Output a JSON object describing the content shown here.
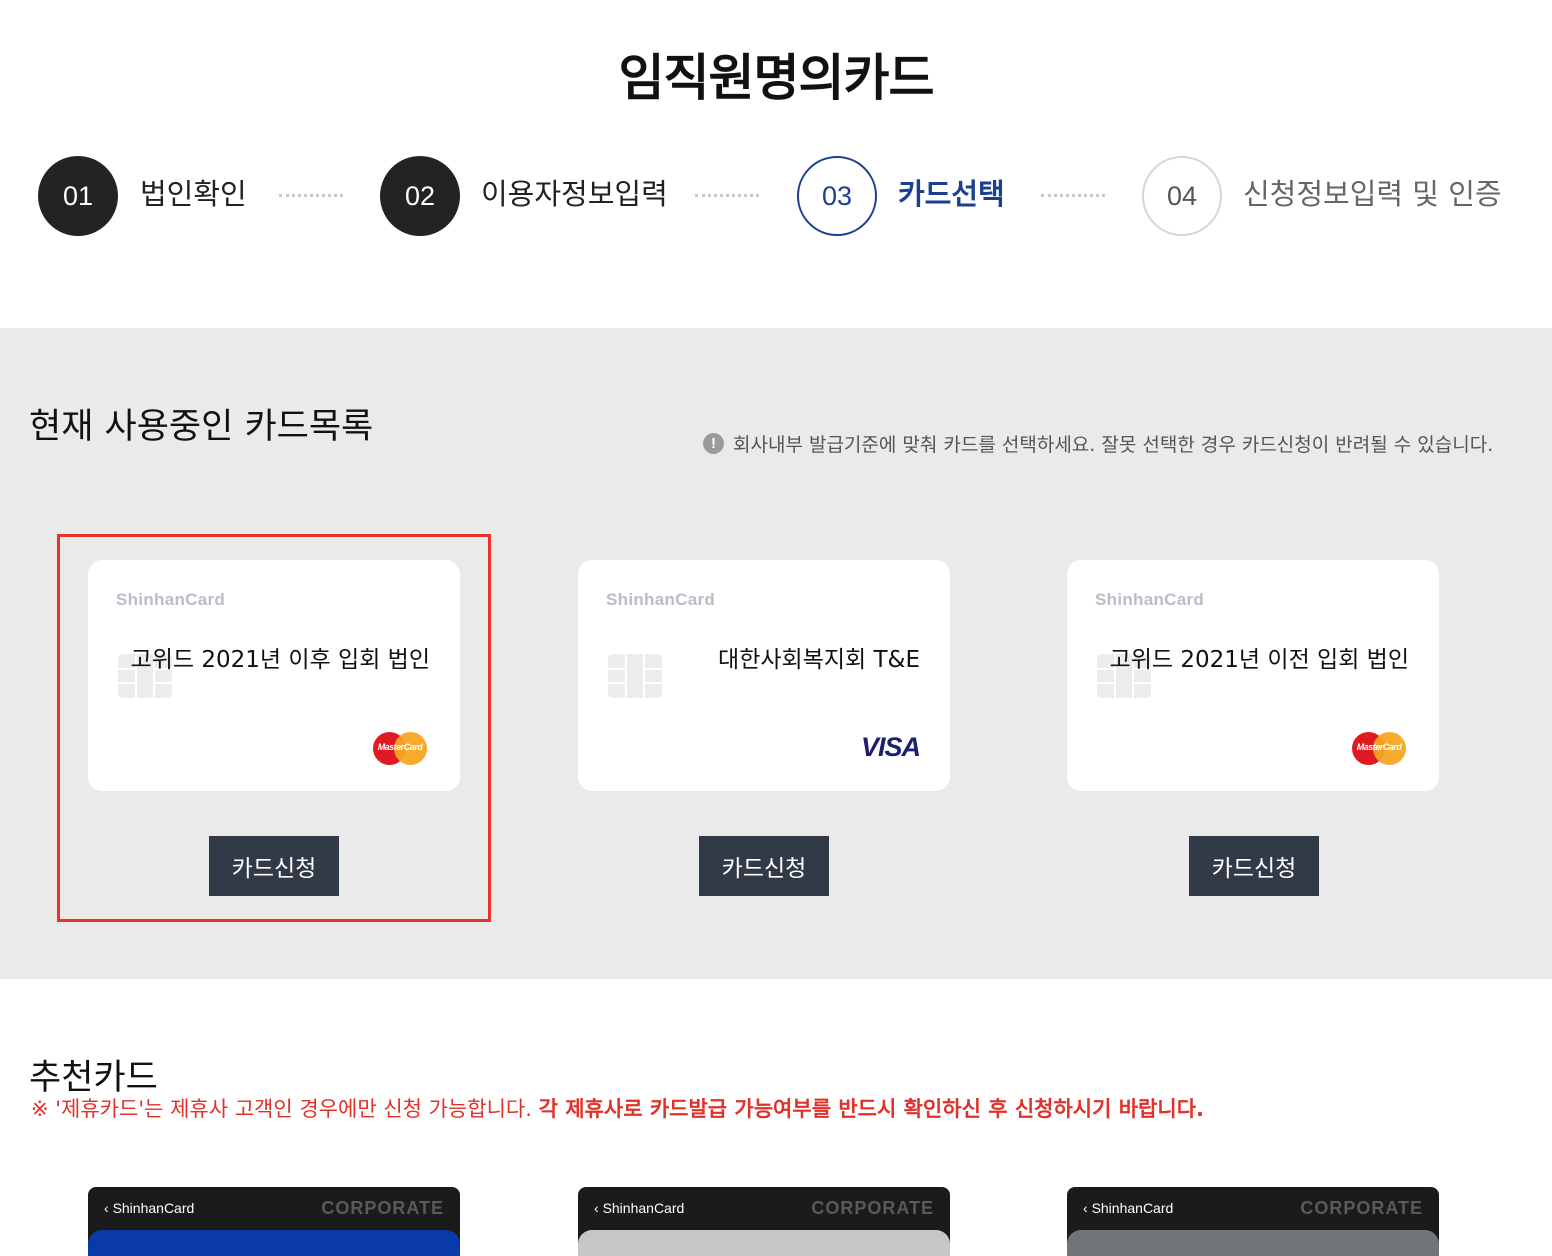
{
  "page": {
    "title": "임직원명의카드"
  },
  "steps": [
    {
      "number": "01",
      "label": "법인확인",
      "state": "done"
    },
    {
      "number": "02",
      "label": "이용자정보입력",
      "state": "done"
    },
    {
      "number": "03",
      "label": "카드선택",
      "state": "active"
    },
    {
      "number": "04",
      "label": "신청정보입력 및 인증",
      "state": "todo"
    }
  ],
  "current_cards": {
    "heading": "현재 사용중인 카드목록",
    "notice": "회사내부 발급기준에 맞춰 카드를 선택하세요. 잘못 선택한 경우 카드신청이 반려될 수 있습니다.",
    "notice_icon": "exclamation-icon",
    "cards": [
      {
        "brand": "ShinhanCard",
        "name": "고위드 2021년 이후 입회 법인",
        "network": "MasterCard",
        "button": "카드신청",
        "selected": true
      },
      {
        "brand": "ShinhanCard",
        "name": "대한사회복지회 T&E",
        "network": "VISA",
        "button": "카드신청",
        "selected": false
      },
      {
        "brand": "ShinhanCard",
        "name": "고위드 2021년 이전 입회 법인",
        "network": "MasterCard",
        "button": "카드신청",
        "selected": false
      }
    ]
  },
  "recommend": {
    "title": "추천카드",
    "note_prefix": "※ '제휴카드'는 제휴사 고객인 경우에만 신청 가능합니다.",
    "note_bold": "각 제휴사로 카드발급 가능여부를 반드시 확인하신 후 신청하시기 바랍니다.",
    "cards": [
      {
        "brand": "ShinhanCard",
        "badge": "CORPORATE",
        "face_color": "#0a3aa8"
      },
      {
        "brand": "ShinhanCard",
        "badge": "CORPORATE",
        "face_color": "#c6c6c8"
      },
      {
        "brand": "ShinhanCard",
        "badge": "CORPORATE",
        "face_color": "#6f7578"
      }
    ]
  },
  "colors": {
    "accent": "#1d3f8f",
    "highlight": "#e8322a",
    "button": "#333a47",
    "notice_red": "#e0312b"
  }
}
